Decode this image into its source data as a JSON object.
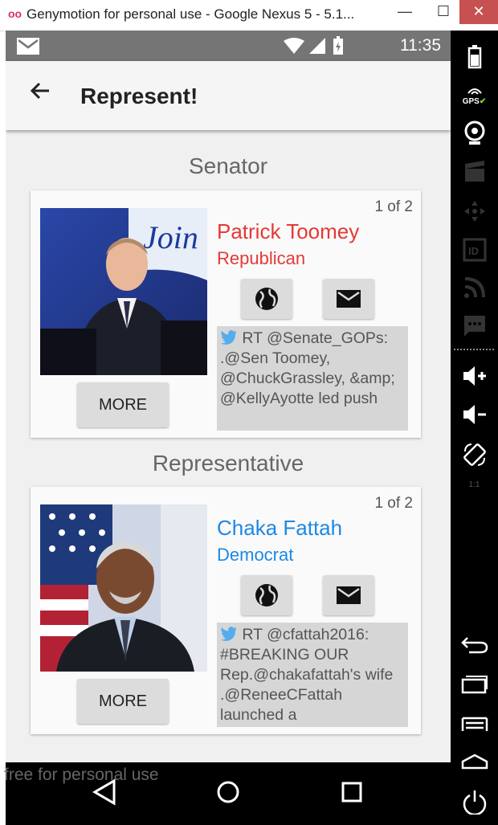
{
  "window": {
    "title": "Genymotion for personal use - Google Nexus 5 - 5.1...",
    "minimize": "—",
    "maximize": "☐",
    "close": "✕"
  },
  "statusbar": {
    "time": "11:35"
  },
  "appbar": {
    "title": "Represent!",
    "back_icon": "arrow-back-icon"
  },
  "sections": [
    {
      "title": "Senator",
      "card": {
        "counter": "1 of 2",
        "name": "Patrick Toomey",
        "party": "Republican",
        "color": "#e53935",
        "more_label": "MORE",
        "tweet": "RT @Senate_GOPs: .@Sen Toomey, @ChuckGrassley, &amp; @KellyAyotte led push"
      }
    },
    {
      "title": "Representative",
      "card": {
        "counter": "1 of 2",
        "name": "Chaka Fattah",
        "party": "Democrat",
        "color": "#1e88e5",
        "more_label": "MORE",
        "tweet": "RT @cfattah2016: #BREAKING OUR Rep.@chakafattah's wife .@ReneeCFattah launched a"
      }
    }
  ],
  "watermark": "free for personal use",
  "toolbar": {
    "gps_label": "GPS",
    "id_label": "ID",
    "ratio_label": "1:1"
  }
}
